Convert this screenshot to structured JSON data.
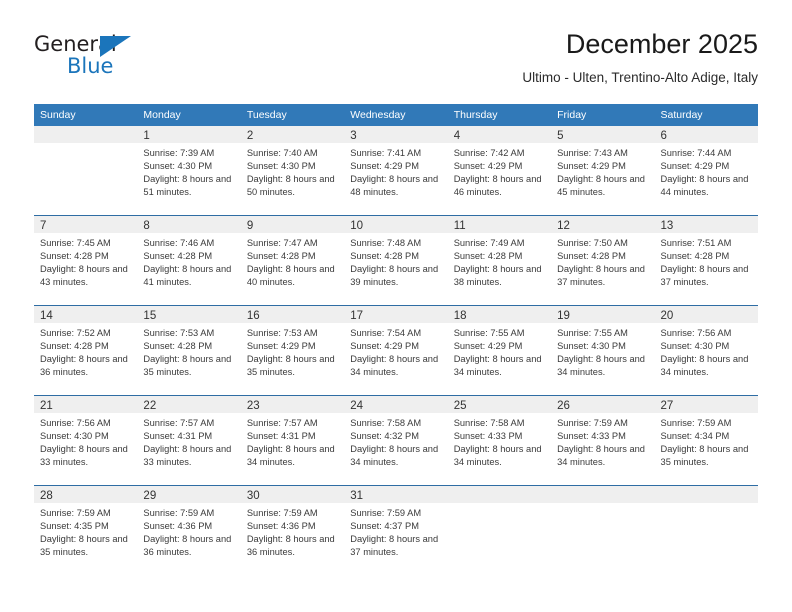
{
  "logo": {
    "primary_text": "General",
    "secondary_text": "Blue",
    "triangle_icon": "blue-triangle-icon",
    "primary_color": "#231f20",
    "accent_color": "#1b75bb"
  },
  "header": {
    "title": "December 2025",
    "subtitle": "Ultimo - Ulten, Trentino-Alto Adige, Italy"
  },
  "colors": {
    "header_blue": "#3179b8",
    "row_separator_blue": "#2e6da4",
    "day_band_gray": "#efefef",
    "text": "#333333"
  },
  "calendar": {
    "weekdays": [
      "Sunday",
      "Monday",
      "Tuesday",
      "Wednesday",
      "Thursday",
      "Friday",
      "Saturday"
    ],
    "weeks": [
      [
        {
          "day": "",
          "empty": true,
          "sunrise": "",
          "sunset": "",
          "daylight": ""
        },
        {
          "day": "1",
          "empty": false,
          "sunrise": "Sunrise: 7:39 AM",
          "sunset": "Sunset: 4:30 PM",
          "daylight": "Daylight: 8 hours and 51 minutes."
        },
        {
          "day": "2",
          "empty": false,
          "sunrise": "Sunrise: 7:40 AM",
          "sunset": "Sunset: 4:30 PM",
          "daylight": "Daylight: 8 hours and 50 minutes."
        },
        {
          "day": "3",
          "empty": false,
          "sunrise": "Sunrise: 7:41 AM",
          "sunset": "Sunset: 4:29 PM",
          "daylight": "Daylight: 8 hours and 48 minutes."
        },
        {
          "day": "4",
          "empty": false,
          "sunrise": "Sunrise: 7:42 AM",
          "sunset": "Sunset: 4:29 PM",
          "daylight": "Daylight: 8 hours and 46 minutes."
        },
        {
          "day": "5",
          "empty": false,
          "sunrise": "Sunrise: 7:43 AM",
          "sunset": "Sunset: 4:29 PM",
          "daylight": "Daylight: 8 hours and 45 minutes."
        },
        {
          "day": "6",
          "empty": false,
          "sunrise": "Sunrise: 7:44 AM",
          "sunset": "Sunset: 4:29 PM",
          "daylight": "Daylight: 8 hours and 44 minutes."
        }
      ],
      [
        {
          "day": "7",
          "empty": false,
          "sunrise": "Sunrise: 7:45 AM",
          "sunset": "Sunset: 4:28 PM",
          "daylight": "Daylight: 8 hours and 43 minutes."
        },
        {
          "day": "8",
          "empty": false,
          "sunrise": "Sunrise: 7:46 AM",
          "sunset": "Sunset: 4:28 PM",
          "daylight": "Daylight: 8 hours and 41 minutes."
        },
        {
          "day": "9",
          "empty": false,
          "sunrise": "Sunrise: 7:47 AM",
          "sunset": "Sunset: 4:28 PM",
          "daylight": "Daylight: 8 hours and 40 minutes."
        },
        {
          "day": "10",
          "empty": false,
          "sunrise": "Sunrise: 7:48 AM",
          "sunset": "Sunset: 4:28 PM",
          "daylight": "Daylight: 8 hours and 39 minutes."
        },
        {
          "day": "11",
          "empty": false,
          "sunrise": "Sunrise: 7:49 AM",
          "sunset": "Sunset: 4:28 PM",
          "daylight": "Daylight: 8 hours and 38 minutes."
        },
        {
          "day": "12",
          "empty": false,
          "sunrise": "Sunrise: 7:50 AM",
          "sunset": "Sunset: 4:28 PM",
          "daylight": "Daylight: 8 hours and 37 minutes."
        },
        {
          "day": "13",
          "empty": false,
          "sunrise": "Sunrise: 7:51 AM",
          "sunset": "Sunset: 4:28 PM",
          "daylight": "Daylight: 8 hours and 37 minutes."
        }
      ],
      [
        {
          "day": "14",
          "empty": false,
          "sunrise": "Sunrise: 7:52 AM",
          "sunset": "Sunset: 4:28 PM",
          "daylight": "Daylight: 8 hours and 36 minutes."
        },
        {
          "day": "15",
          "empty": false,
          "sunrise": "Sunrise: 7:53 AM",
          "sunset": "Sunset: 4:28 PM",
          "daylight": "Daylight: 8 hours and 35 minutes."
        },
        {
          "day": "16",
          "empty": false,
          "sunrise": "Sunrise: 7:53 AM",
          "sunset": "Sunset: 4:29 PM",
          "daylight": "Daylight: 8 hours and 35 minutes."
        },
        {
          "day": "17",
          "empty": false,
          "sunrise": "Sunrise: 7:54 AM",
          "sunset": "Sunset: 4:29 PM",
          "daylight": "Daylight: 8 hours and 34 minutes."
        },
        {
          "day": "18",
          "empty": false,
          "sunrise": "Sunrise: 7:55 AM",
          "sunset": "Sunset: 4:29 PM",
          "daylight": "Daylight: 8 hours and 34 minutes."
        },
        {
          "day": "19",
          "empty": false,
          "sunrise": "Sunrise: 7:55 AM",
          "sunset": "Sunset: 4:30 PM",
          "daylight": "Daylight: 8 hours and 34 minutes."
        },
        {
          "day": "20",
          "empty": false,
          "sunrise": "Sunrise: 7:56 AM",
          "sunset": "Sunset: 4:30 PM",
          "daylight": "Daylight: 8 hours and 34 minutes."
        }
      ],
      [
        {
          "day": "21",
          "empty": false,
          "sunrise": "Sunrise: 7:56 AM",
          "sunset": "Sunset: 4:30 PM",
          "daylight": "Daylight: 8 hours and 33 minutes."
        },
        {
          "day": "22",
          "empty": false,
          "sunrise": "Sunrise: 7:57 AM",
          "sunset": "Sunset: 4:31 PM",
          "daylight": "Daylight: 8 hours and 33 minutes."
        },
        {
          "day": "23",
          "empty": false,
          "sunrise": "Sunrise: 7:57 AM",
          "sunset": "Sunset: 4:31 PM",
          "daylight": "Daylight: 8 hours and 34 minutes."
        },
        {
          "day": "24",
          "empty": false,
          "sunrise": "Sunrise: 7:58 AM",
          "sunset": "Sunset: 4:32 PM",
          "daylight": "Daylight: 8 hours and 34 minutes."
        },
        {
          "day": "25",
          "empty": false,
          "sunrise": "Sunrise: 7:58 AM",
          "sunset": "Sunset: 4:33 PM",
          "daylight": "Daylight: 8 hours and 34 minutes."
        },
        {
          "day": "26",
          "empty": false,
          "sunrise": "Sunrise: 7:59 AM",
          "sunset": "Sunset: 4:33 PM",
          "daylight": "Daylight: 8 hours and 34 minutes."
        },
        {
          "day": "27",
          "empty": false,
          "sunrise": "Sunrise: 7:59 AM",
          "sunset": "Sunset: 4:34 PM",
          "daylight": "Daylight: 8 hours and 35 minutes."
        }
      ],
      [
        {
          "day": "28",
          "empty": false,
          "sunrise": "Sunrise: 7:59 AM",
          "sunset": "Sunset: 4:35 PM",
          "daylight": "Daylight: 8 hours and 35 minutes."
        },
        {
          "day": "29",
          "empty": false,
          "sunrise": "Sunrise: 7:59 AM",
          "sunset": "Sunset: 4:36 PM",
          "daylight": "Daylight: 8 hours and 36 minutes."
        },
        {
          "day": "30",
          "empty": false,
          "sunrise": "Sunrise: 7:59 AM",
          "sunset": "Sunset: 4:36 PM",
          "daylight": "Daylight: 8 hours and 36 minutes."
        },
        {
          "day": "31",
          "empty": false,
          "sunrise": "Sunrise: 7:59 AM",
          "sunset": "Sunset: 4:37 PM",
          "daylight": "Daylight: 8 hours and 37 minutes."
        },
        {
          "day": "",
          "empty": true,
          "sunrise": "",
          "sunset": "",
          "daylight": ""
        },
        {
          "day": "",
          "empty": true,
          "sunrise": "",
          "sunset": "",
          "daylight": ""
        },
        {
          "day": "",
          "empty": true,
          "sunrise": "",
          "sunset": "",
          "daylight": ""
        }
      ]
    ]
  }
}
